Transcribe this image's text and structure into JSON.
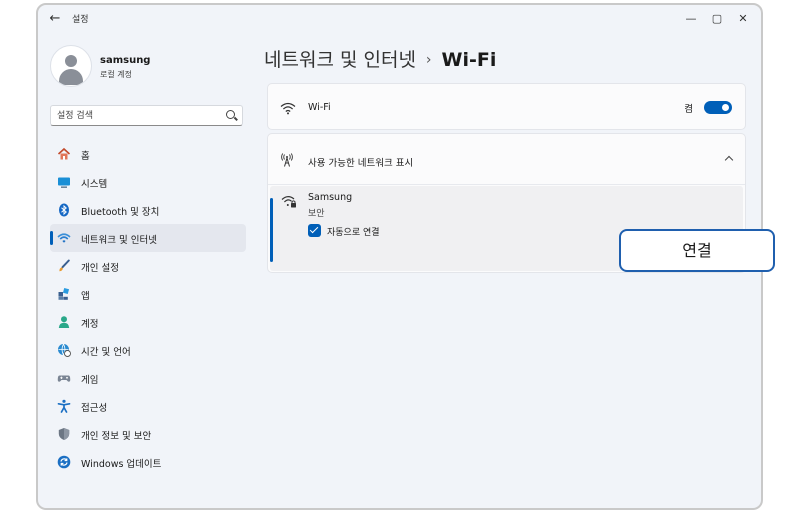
{
  "app": {
    "title": "설정"
  },
  "window_controls": {
    "minimize": "—",
    "maximize": "▢",
    "close": "✕",
    "back": "←"
  },
  "profile": {
    "name": "samsung",
    "subtitle": "로컬 계정"
  },
  "search": {
    "placeholder": "설정 검색"
  },
  "sidebar": {
    "items": [
      {
        "label": "홈",
        "icon": "home-icon"
      },
      {
        "label": "시스템",
        "icon": "system-icon"
      },
      {
        "label": "Bluetooth 및 장치",
        "icon": "bluetooth-icon"
      },
      {
        "label": "네트워크 및 인터넷",
        "icon": "network-icon",
        "active": true
      },
      {
        "label": "개인 설정",
        "icon": "personalization-icon"
      },
      {
        "label": "앱",
        "icon": "apps-icon"
      },
      {
        "label": "계정",
        "icon": "accounts-icon"
      },
      {
        "label": "시간 및 언어",
        "icon": "time-language-icon"
      },
      {
        "label": "게임",
        "icon": "gaming-icon"
      },
      {
        "label": "접근성",
        "icon": "accessibility-icon"
      },
      {
        "label": "개인 정보 및 보안",
        "icon": "privacy-icon"
      },
      {
        "label": "Windows 업데이트",
        "icon": "windows-update-icon"
      }
    ]
  },
  "breadcrumb": {
    "parent": "네트워크 및 인터넷",
    "separator": "›",
    "current": "Wi-Fi"
  },
  "wifi": {
    "label": "Wi-Fi",
    "toggle_label": "켬",
    "enabled": true
  },
  "available": {
    "label": "사용 가능한 네트워크 표시"
  },
  "network": {
    "name": "Samsung",
    "security": "보안",
    "auto_connect_label": "자동으로 연결",
    "auto_connect": true
  },
  "connect_button": {
    "label": "연결"
  },
  "colors": {
    "accent": "#005fb8",
    "window_bg": "#f1f4f9",
    "card_bg": "#fbfbfc"
  }
}
